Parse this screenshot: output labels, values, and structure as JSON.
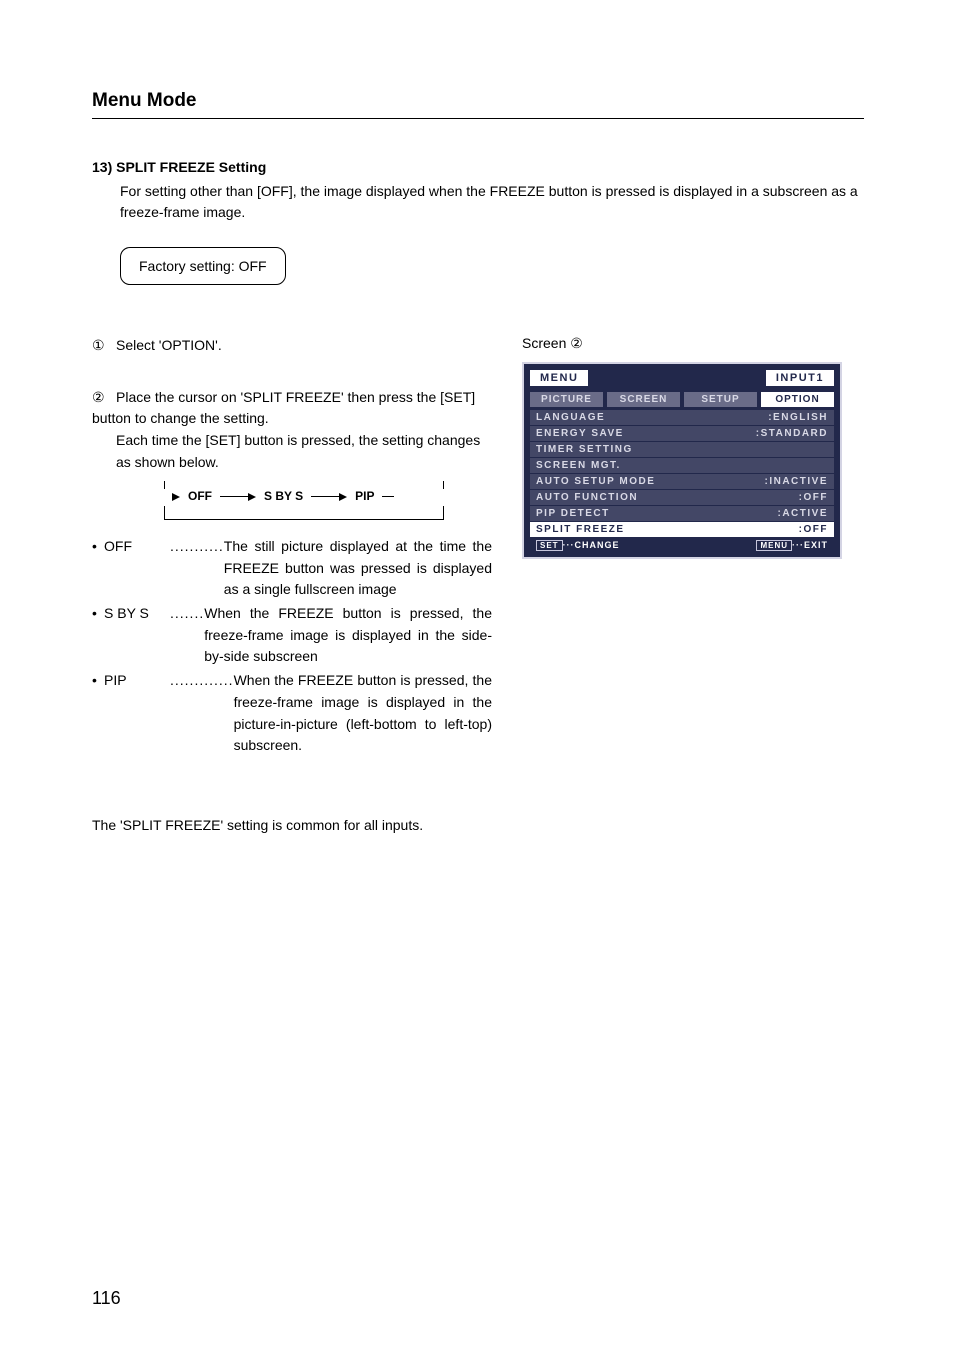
{
  "page": {
    "title": "Menu Mode",
    "number": "116"
  },
  "section": {
    "heading": "13) SPLIT FREEZE Setting",
    "intro": "For setting other than [OFF], the image displayed when the FREEZE button is pressed is displayed in a subscreen as a freeze-frame image.",
    "factory_setting": "Factory setting:  OFF"
  },
  "steps": {
    "s1_num": "①",
    "s1_text": "Select 'OPTION'.",
    "s2_num": "②",
    "s2_text1": "Place the cursor on 'SPLIT FREEZE' then press the [SET] button to change the setting.",
    "s2_text2": "Each time the [SET] button is pressed, the setting changes as shown below.",
    "cycle": {
      "a": "OFF",
      "b": "S BY S",
      "c": "PIP"
    },
    "bullets": [
      {
        "term": "OFF",
        "dots": "...........",
        "desc": "The still picture displayed at the time the FREEZE button was pressed is displayed as a single fullscreen image"
      },
      {
        "term": "S BY S",
        "dots": ".......",
        "desc": "When the FREEZE button is pressed, the freeze-frame image is displayed in the side-by-side subscreen"
      },
      {
        "term": "PIP",
        "dots": ".............",
        "desc": "When the FREEZE button is pressed, the freeze-frame image is displayed in the picture-in-picture (left-bottom to left-top) subscreen."
      }
    ],
    "note": "The 'SPLIT FREEZE' setting is common for all inputs."
  },
  "screen": {
    "label_prefix": "Screen ",
    "label_num": "②",
    "menu_title": "MENU",
    "input_badge": "INPUT1",
    "tabs": [
      "PICTURE",
      "SCREEN",
      "SETUP",
      "OPTION"
    ],
    "rows": [
      {
        "k": "LANGUAGE",
        "v": ":ENGLISH",
        "hl": false
      },
      {
        "k": "ENERGY SAVE",
        "v": ":STANDARD",
        "hl": false
      },
      {
        "k": "TIMER SETTING",
        "v": "",
        "hl": false
      },
      {
        "k": "SCREEN MGT.",
        "v": "",
        "hl": false
      },
      {
        "k": "AUTO SETUP MODE",
        "v": ":INACTIVE",
        "hl": false
      },
      {
        "k": "AUTO FUNCTION",
        "v": ":OFF",
        "hl": false
      },
      {
        "k": "PIP DETECT",
        "v": ":ACTIVE",
        "hl": false
      },
      {
        "k": "SPLIT FREEZE",
        "v": " :OFF",
        "hl": true
      }
    ],
    "foot_left_btn": "SET",
    "foot_left_text": "···CHANGE",
    "foot_right_btn": "MENU",
    "foot_right_text": "···EXIT"
  }
}
